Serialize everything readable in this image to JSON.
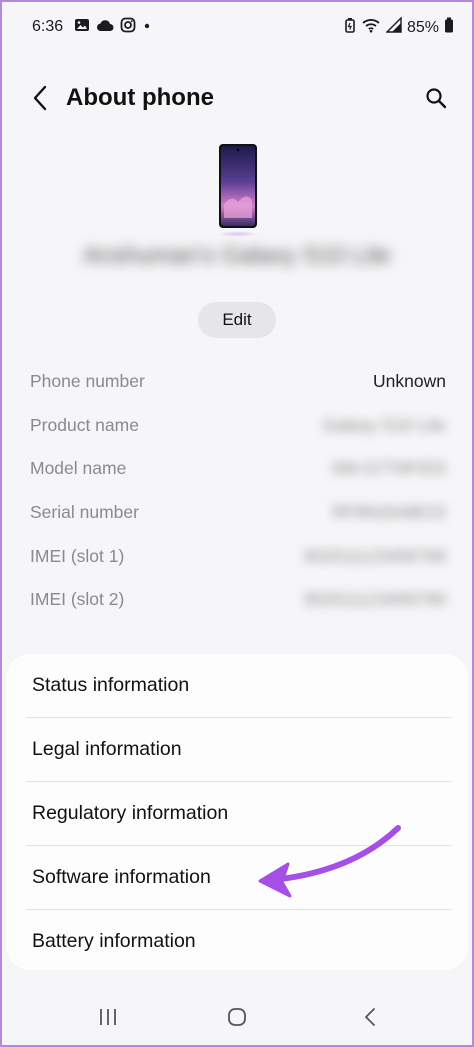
{
  "status_bar": {
    "time": "6:36",
    "left_icons": [
      "gallery-icon",
      "cloud-icon",
      "instagram-icon",
      "dot-icon"
    ],
    "right_icons": [
      "battery-saver-icon",
      "wifi-icon",
      "signal-icon",
      "battery-icon"
    ],
    "battery_percent": "85%"
  },
  "header": {
    "title": "About phone",
    "back_icon": "chevron-left-icon",
    "search_icon": "search-icon"
  },
  "device": {
    "name": "Anshuman's Galaxy S10 Lite",
    "edit_label": "Edit"
  },
  "info": [
    {
      "label": "Phone number",
      "value": "Unknown"
    },
    {
      "label": "Product name",
      "value": "Galaxy S10 Lite"
    },
    {
      "label": "Model name",
      "value": "SM-G770F/DS"
    },
    {
      "label": "Serial number",
      "value": "RF8N20ABCD"
    },
    {
      "label": "IMEI (slot 1)",
      "value": "352011123456789"
    },
    {
      "label": "IMEI (slot 2)",
      "value": "352011123456790"
    }
  ],
  "menu": [
    {
      "label": "Status information"
    },
    {
      "label": "Legal information"
    },
    {
      "label": "Regulatory information"
    },
    {
      "label": "Software information"
    },
    {
      "label": "Battery information"
    }
  ],
  "colors": {
    "arrow": "#a64fe6",
    "frame_border": "#b388e0"
  },
  "nav": {
    "recents_icon": "recents-icon",
    "home_icon": "home-icon",
    "back_icon": "back-icon"
  }
}
